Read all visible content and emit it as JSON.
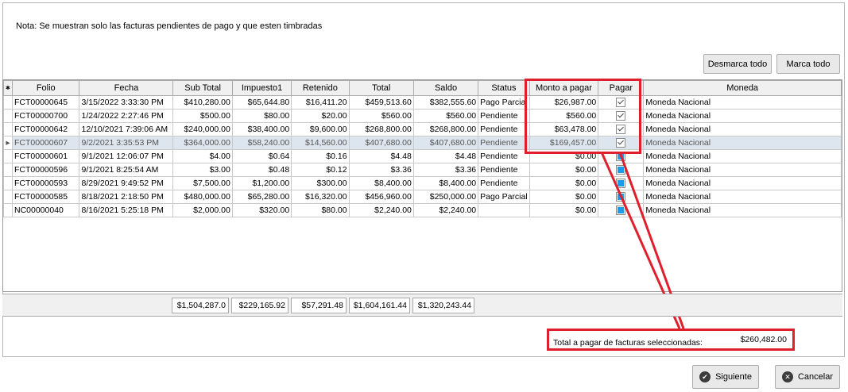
{
  "note": "Nota: Se muestran solo las facturas pendientes de pago y que esten timbradas",
  "buttons": {
    "desmarca": "Desmarca todo",
    "marca": "Marca todo",
    "siguiente": "Siguiente",
    "cancelar": "Cancelar"
  },
  "columns": [
    "Folio",
    "Fecha",
    "Sub Total",
    "Impuesto1",
    "Retenido",
    "Total",
    "Saldo",
    "Status",
    "Monto a pagar",
    "Pagar",
    "Moneda"
  ],
  "rows": [
    {
      "folio": "FCT00000645",
      "fecha": "3/15/2022 3:33:30 PM",
      "subtotal": "$410,280.00",
      "impuesto": "$65,644.80",
      "retenido": "$16,411.20",
      "total": "$459,513.60",
      "saldo": "$382,555.60",
      "status": "Pago Parcial",
      "monto": "$26,987.00",
      "pagar": true,
      "moneda": "Moneda Nacional",
      "selected": false
    },
    {
      "folio": "FCT00000700",
      "fecha": "1/24/2022 2:27:46 PM",
      "subtotal": "$500.00",
      "impuesto": "$80.00",
      "retenido": "$20.00",
      "total": "$560.00",
      "saldo": "$560.00",
      "status": "Pendiente",
      "monto": "$560.00",
      "pagar": true,
      "moneda": "Moneda Nacional",
      "selected": false
    },
    {
      "folio": "FCT00000642",
      "fecha": "12/10/2021 7:39:06 AM",
      "subtotal": "$240,000.00",
      "impuesto": "$38,400.00",
      "retenido": "$9,600.00",
      "total": "$268,800.00",
      "saldo": "$268,800.00",
      "status": "Pendiente",
      "monto": "$63,478.00",
      "pagar": true,
      "moneda": "Moneda Nacional",
      "selected": false
    },
    {
      "folio": "FCT00000607",
      "fecha": "9/2/2021 3:35:53 PM",
      "subtotal": "$364,000.00",
      "impuesto": "$58,240.00",
      "retenido": "$14,560.00",
      "total": "$407,680.00",
      "saldo": "$407,680.00",
      "status": "Pendiente",
      "monto": "$169,457.00",
      "pagar": true,
      "moneda": "Moneda Nacional",
      "selected": true
    },
    {
      "folio": "FCT00000601",
      "fecha": "9/1/2021 12:06:07 PM",
      "subtotal": "$4.00",
      "impuesto": "$0.64",
      "retenido": "$0.16",
      "total": "$4.48",
      "saldo": "$4.48",
      "status": "Pendiente",
      "monto": "$0.00",
      "pagar": false,
      "moneda": "Moneda Nacional",
      "selected": false
    },
    {
      "folio": "FCT00000596",
      "fecha": "9/1/2021 8:25:54 AM",
      "subtotal": "$3.00",
      "impuesto": "$0.48",
      "retenido": "$0.12",
      "total": "$3.36",
      "saldo": "$3.36",
      "status": "Pendiente",
      "monto": "$0.00",
      "pagar": false,
      "moneda": "Moneda Nacional",
      "selected": false
    },
    {
      "folio": "FCT00000593",
      "fecha": "8/29/2021 9:49:52 PM",
      "subtotal": "$7,500.00",
      "impuesto": "$1,200.00",
      "retenido": "$300.00",
      "total": "$8,400.00",
      "saldo": "$8,400.00",
      "status": "Pendiente",
      "monto": "$0.00",
      "pagar": false,
      "moneda": "Moneda Nacional",
      "selected": false
    },
    {
      "folio": "FCT00000585",
      "fecha": "8/18/2021 2:18:50 PM",
      "subtotal": "$480,000.00",
      "impuesto": "$65,280.00",
      "retenido": "$16,320.00",
      "total": "$456,960.00",
      "saldo": "$250,000.00",
      "status": "Pago Parcial",
      "monto": "$0.00",
      "pagar": false,
      "moneda": "Moneda Nacional",
      "selected": false
    },
    {
      "folio": "NC00000040",
      "fecha": "8/16/2021 5:25:18 PM",
      "subtotal": "$2,000.00",
      "impuesto": "$320.00",
      "retenido": "$80.00",
      "total": "$2,240.00",
      "saldo": "$2,240.00",
      "status": "",
      "monto": "$0.00",
      "pagar": false,
      "moneda": "Moneda Nacional",
      "selected": false
    }
  ],
  "totals": {
    "subtotal": "$1,504,287.0",
    "impuesto": "$229,165.92",
    "retenido": "$57,291.48",
    "total": "$1,604,161.44",
    "saldo": "$1,320,243.44"
  },
  "total_label": "Total a pagar de facturas seleccionadas:",
  "total_value": "$260,482.00",
  "colors": {
    "highlight": "#e01f2d",
    "checkbox_blue": "#1e9be8",
    "selected_row": "#dde5ee"
  }
}
